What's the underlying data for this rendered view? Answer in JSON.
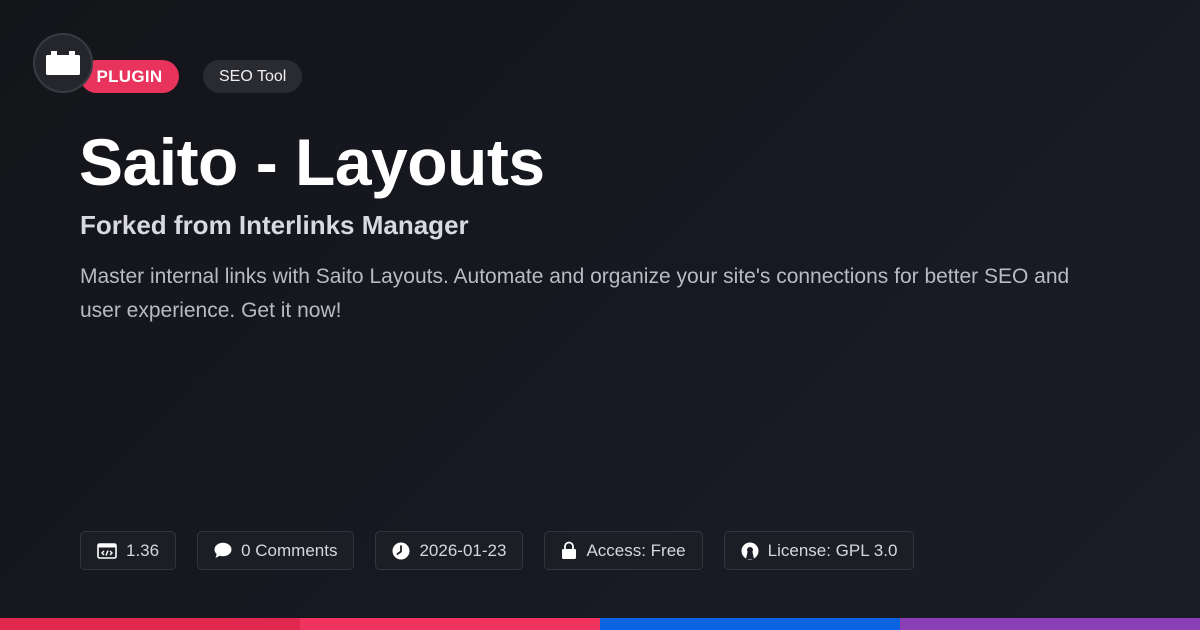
{
  "header": {
    "logo_icon": "plugin-block-icon",
    "tags": [
      "PLUGIN",
      "SEO Tool"
    ]
  },
  "main": {
    "title": "Saito - Layouts",
    "subtitle": "Forked from Interlinks Manager",
    "description": "Master internal links with Saito Layouts. Automate and organize your site's connections for better SEO and user experience. Get it now!"
  },
  "meta": {
    "version": "1.36",
    "comments": "0 Comments",
    "date": "2026-01-23",
    "access": "Access: Free",
    "license": "License: GPL 3.0"
  },
  "colors": {
    "accent": "#e8335d",
    "bar": [
      "#e0284f",
      "#f0325f",
      "#0a63e0",
      "#8a3fb5"
    ]
  }
}
